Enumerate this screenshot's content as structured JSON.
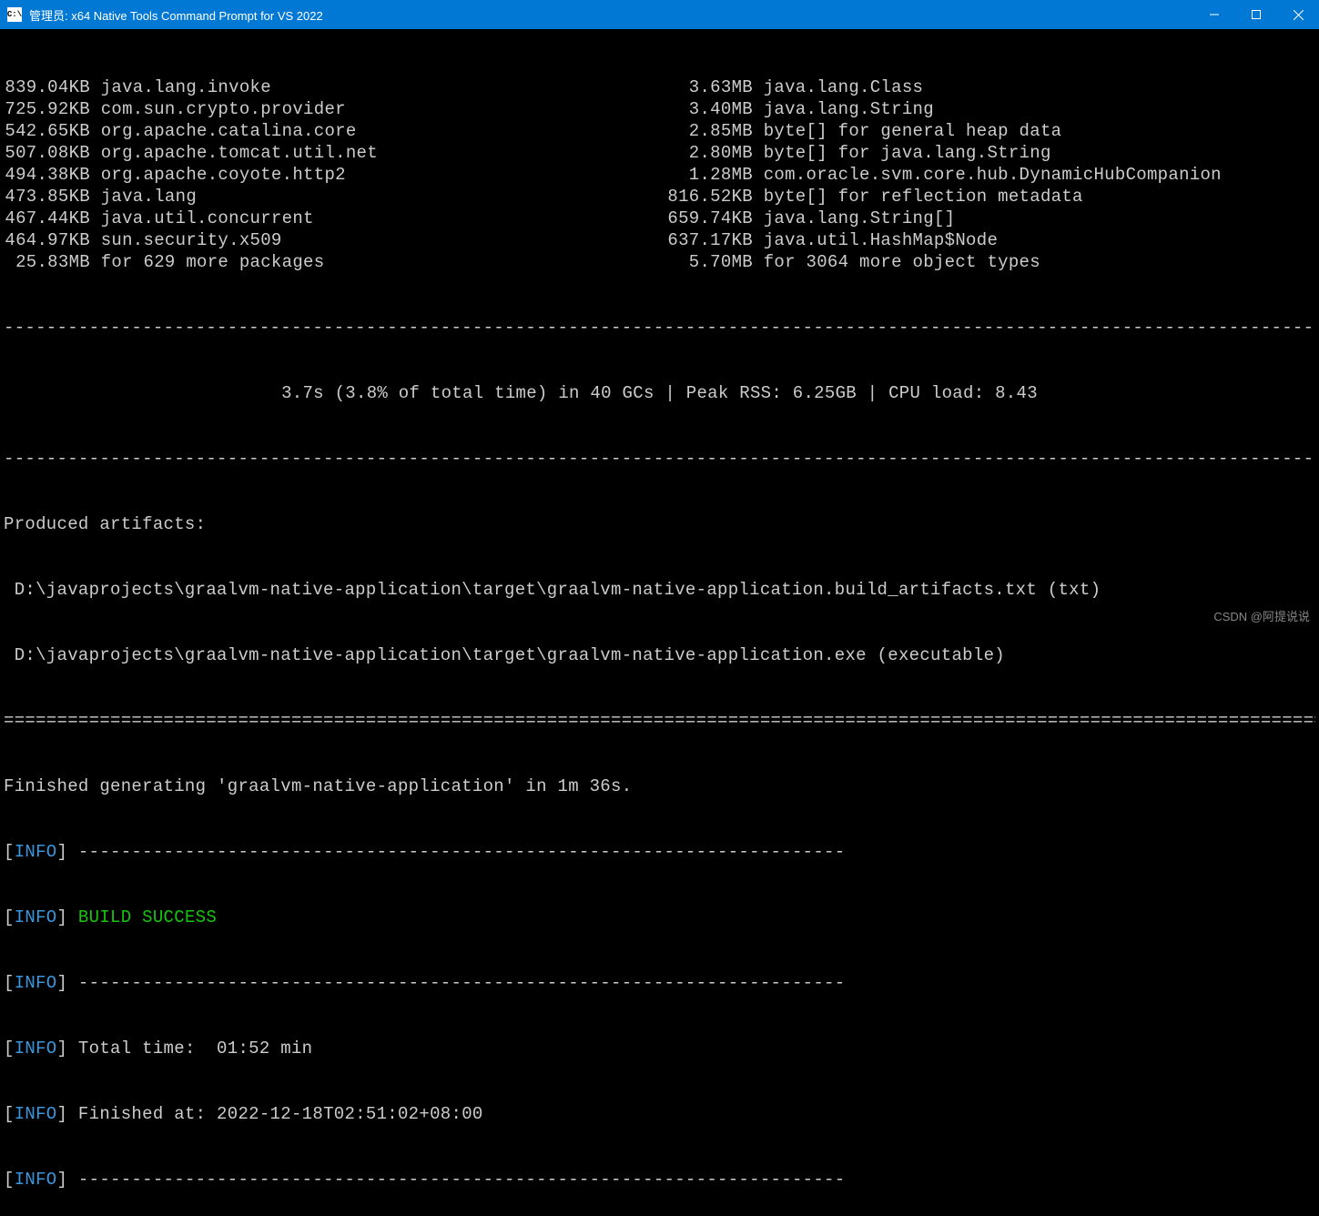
{
  "titlebar": {
    "icon_text": "C:\\",
    "title": "管理员: x64 Native Tools Command Prompt for VS 2022"
  },
  "package_rows": [
    {
      "lsize": "839.04KB",
      "lname": "java.lang.invoke",
      "rsize": "3.63MB",
      "rname": "java.lang.Class"
    },
    {
      "lsize": "725.92KB",
      "lname": "com.sun.crypto.provider",
      "rsize": "3.40MB",
      "rname": "java.lang.String"
    },
    {
      "lsize": "542.65KB",
      "lname": "org.apache.catalina.core",
      "rsize": "2.85MB",
      "rname": "byte[] for general heap data"
    },
    {
      "lsize": "507.08KB",
      "lname": "org.apache.tomcat.util.net",
      "rsize": "2.80MB",
      "rname": "byte[] for java.lang.String"
    },
    {
      "lsize": "494.38KB",
      "lname": "org.apache.coyote.http2",
      "rsize": "1.28MB",
      "rname": "com.oracle.svm.core.hub.DynamicHubCompanion"
    },
    {
      "lsize": "473.85KB",
      "lname": "java.lang",
      "rsize": "816.52KB",
      "rname": "byte[] for reflection metadata"
    },
    {
      "lsize": "467.44KB",
      "lname": "java.util.concurrent",
      "rsize": "659.74KB",
      "rname": "java.lang.String[]"
    },
    {
      "lsize": "464.97KB",
      "lname": "sun.security.x509",
      "rsize": "637.17KB",
      "rname": "java.util.HashMap$Node"
    },
    {
      "lsize": "25.83MB",
      "lname": "for 629 more packages",
      "rsize": "5.70MB",
      "rname": "for 3064 more object types"
    }
  ],
  "dashed_separator": "------------------------------------------------------------------------------------------------------------------------------------------------",
  "stats_line": "3.7s (3.8% of total time) in 40 GCs | Peak RSS: 6.25GB | CPU load: 8.43",
  "artifacts": {
    "header": "Produced artifacts:",
    "lines": [
      " D:\\javaprojects\\graalvm-native-application\\target\\graalvm-native-application.build_artifacts.txt (txt)",
      " D:\\javaprojects\\graalvm-native-application\\target\\graalvm-native-application.exe (executable)"
    ]
  },
  "equals_separator": "================================================================================================================================================",
  "finished_line": "Finished generating 'graalvm-native-application' in 1m 36s.",
  "info_tag": "INFO",
  "maven": {
    "dash_line": "------------------------------------------------------------------------",
    "build_success": "BUILD SUCCESS",
    "total_time": "Total time:  01:52 min",
    "finished_at": "Finished at: 2022-12-18T02:51:02+08:00"
  },
  "watermark": "CSDN @阿提说说"
}
